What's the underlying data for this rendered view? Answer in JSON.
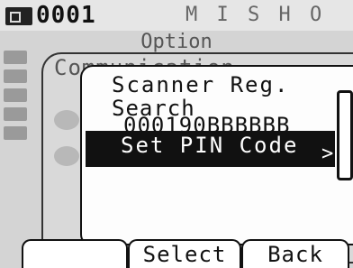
{
  "status": {
    "device_id": "0001",
    "icons": "M I S H O"
  },
  "option_window": {
    "title": "Option"
  },
  "communication_window": {
    "title": "Communication"
  },
  "scanner_window": {
    "title": "Scanner Reg.",
    "items": [
      {
        "label": "Search",
        "value": "000190BBBBBB"
      },
      {
        "label": "Set PIN Code",
        "arrow": ">"
      }
    ],
    "selected_index": 1
  },
  "softkeys": [
    "",
    "Select",
    "Back"
  ]
}
